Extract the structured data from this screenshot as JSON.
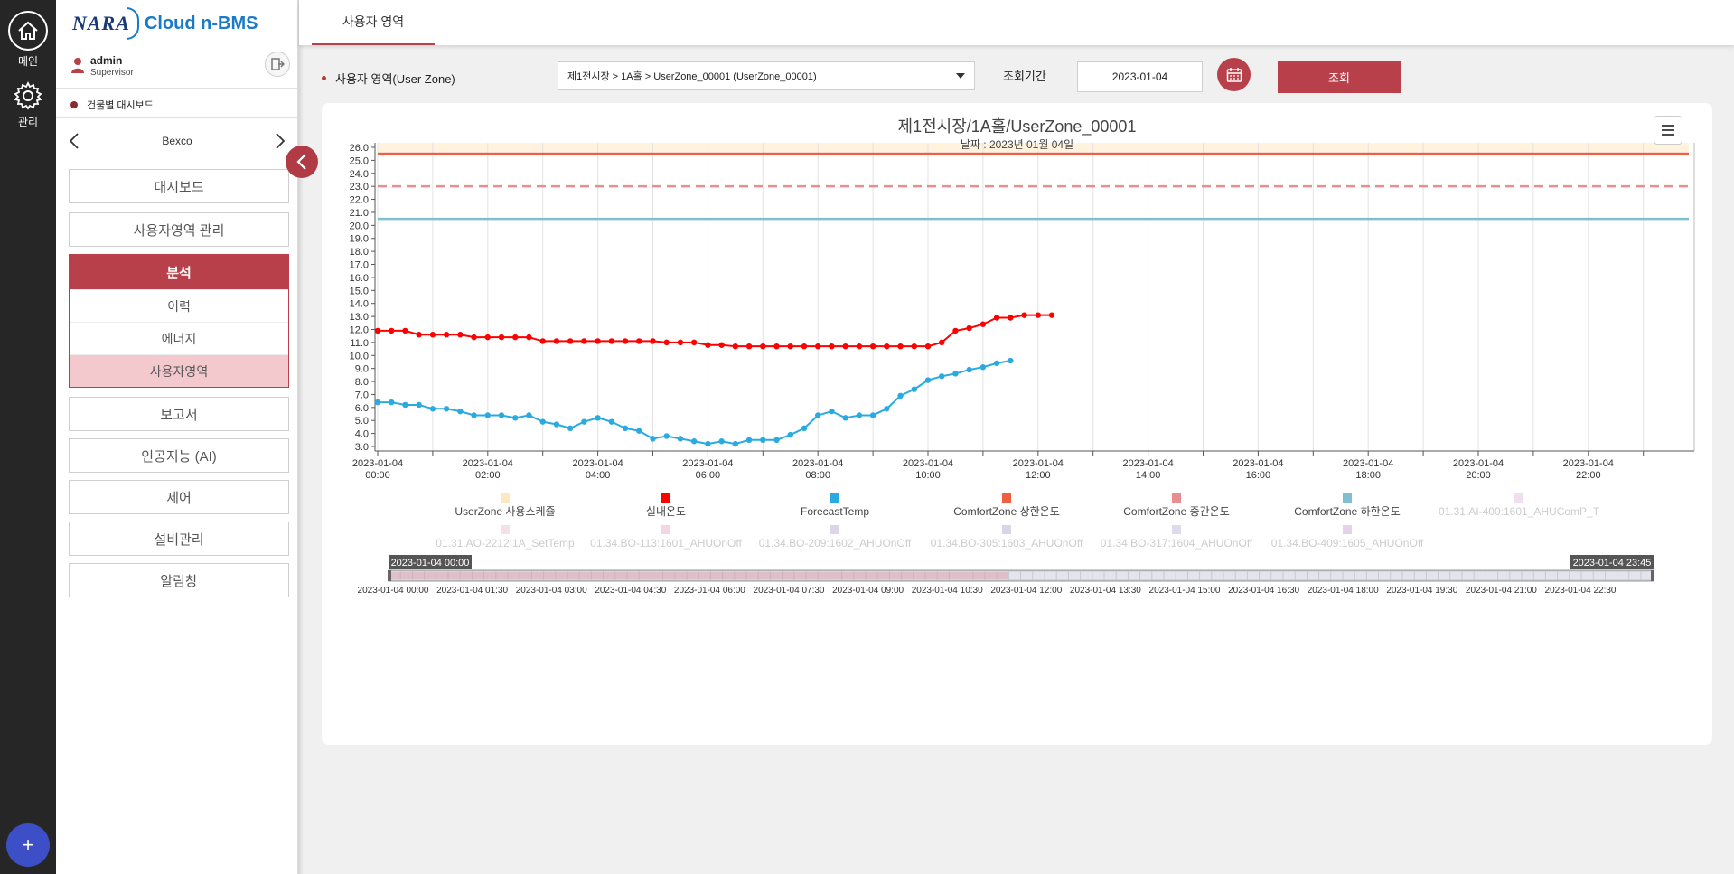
{
  "rail": {
    "main_label": "메인",
    "admin_label": "관리",
    "fab": "+"
  },
  "brand": {
    "nara": "NARA",
    "product": "Cloud n-BMS"
  },
  "user": {
    "name": "admin",
    "role": "Supervisor"
  },
  "building_dashboard": "건물별 대시보드",
  "site": "Bexco",
  "menu": {
    "dashboard": "대시보드",
    "userzone_mgmt": "사용자영역 관리",
    "analysis": "분석",
    "analysis_items": [
      "이력",
      "에너지",
      "사용자영역"
    ],
    "report": "보고서",
    "ai": "인공지능 (AI)",
    "control": "제어",
    "equipment": "설비관리",
    "alarm": "알림창"
  },
  "tab": {
    "label": "사용자 영역"
  },
  "filter": {
    "zone_label": "사용자 영역(User Zone)",
    "zone_value": "제1전시장 > 1A홀 > UserZone_00001 (UserZone_00001)",
    "period_label": "조회기간",
    "date": "2023-01-04",
    "query_label": "조회"
  },
  "colors": {
    "brand_red": "#b8404a",
    "indoor": "#ff0000",
    "forecast": "#29abe2",
    "upper": "#f06040",
    "middle": "#e88e90",
    "lower": "#7ec0d0",
    "schedule": "#fff3dd"
  },
  "chart_data": {
    "type": "line",
    "title": "제1전시장/1A홀/UserZone_00001",
    "subtitle": "날짜 : 2023년 01월 04일",
    "ylim": [
      3.0,
      26.0
    ],
    "y_ticks": [
      "3.0",
      "4.0",
      "5.0",
      "6.0",
      "7.0",
      "8.0",
      "9.0",
      "10.0",
      "11.0",
      "12.0",
      "13.0",
      "14.0",
      "15.0",
      "16.0",
      "17.0",
      "18.0",
      "19.0",
      "20.0",
      "21.0",
      "22.0",
      "23.0",
      "24.0",
      "25.0",
      "26.0"
    ],
    "x_ticks": [
      [
        "2023-01-04",
        "00:00"
      ],
      [
        "2023-01-04",
        "02:00"
      ],
      [
        "2023-01-04",
        "04:00"
      ],
      [
        "2023-01-04",
        "06:00"
      ],
      [
        "2023-01-04",
        "08:00"
      ],
      [
        "2023-01-04",
        "10:00"
      ],
      [
        "2023-01-04",
        "12:00"
      ],
      [
        "2023-01-04",
        "14:00"
      ],
      [
        "2023-01-04",
        "16:00"
      ],
      [
        "2023-01-04",
        "18:00"
      ],
      [
        "2023-01-04",
        "20:00"
      ],
      [
        "2023-01-04",
        "22:00"
      ]
    ],
    "x_interval_minutes": 15,
    "series": [
      {
        "name": "실내온도",
        "values": [
          11.9,
          11.9,
          11.9,
          11.6,
          11.6,
          11.6,
          11.6,
          11.4,
          11.4,
          11.4,
          11.4,
          11.4,
          11.1,
          11.1,
          11.1,
          11.1,
          11.1,
          11.1,
          11.1,
          11.1,
          11.1,
          11.0,
          11.0,
          11.0,
          10.8,
          10.8,
          10.7,
          10.7,
          10.7,
          10.7,
          10.7,
          10.7,
          10.7,
          10.7,
          10.7,
          10.7,
          10.7,
          10.7,
          10.7,
          10.7,
          10.7,
          11.0,
          11.9,
          12.1,
          12.4,
          12.9,
          12.9,
          13.1,
          13.1,
          13.1
        ]
      },
      {
        "name": "ForecastTemp",
        "values": [
          6.4,
          6.4,
          6.2,
          6.2,
          5.9,
          5.9,
          5.7,
          5.4,
          5.4,
          5.4,
          5.2,
          5.4,
          4.9,
          4.7,
          4.4,
          4.9,
          5.2,
          4.9,
          4.4,
          4.2,
          3.6,
          3.8,
          3.6,
          3.4,
          3.2,
          3.4,
          3.2,
          3.5,
          3.5,
          3.5,
          3.9,
          4.4,
          5.4,
          5.7,
          5.2,
          5.4,
          5.4,
          5.9,
          6.9,
          7.4,
          8.1,
          8.4,
          8.6,
          8.9,
          9.1,
          9.4,
          9.6
        ]
      },
      {
        "name": "ComfortZone 상한온도",
        "values": [
          25.5
        ]
      },
      {
        "name": "ComfortZone 중간온도",
        "values": [
          23.0
        ]
      },
      {
        "name": "ComfortZone 하한온도",
        "values": [
          20.5
        ]
      }
    ],
    "legend": [
      {
        "label": "UserZone 사용스케쥴",
        "color": "#ffe7c4",
        "active": true
      },
      {
        "label": "실내온도",
        "color": "#ff0000",
        "active": true
      },
      {
        "label": "ForecastTemp",
        "color": "#29abe2",
        "active": true
      },
      {
        "label": "ComfortZone 상한온도",
        "color": "#f06040",
        "active": true
      },
      {
        "label": "ComfortZone 중간온도",
        "color": "#e88e90",
        "active": true
      },
      {
        "label": "ComfortZone 하한온도",
        "color": "#7ec0d0",
        "active": true
      },
      {
        "label": "01.31.AI-400:1601_AHUComP_T",
        "color": "#f0dff0",
        "active": false
      },
      {
        "label": "01.31.AO-2212:1A_SetTemp",
        "color": "#f5dfe8",
        "active": false
      },
      {
        "label": "01.34.BO-113:1601_AHUOnOff",
        "color": "#f3d6e4",
        "active": false
      },
      {
        "label": "01.34.BO-209:1602_AHUOnOff",
        "color": "#dfd3e8",
        "active": false
      },
      {
        "label": "01.34.BO-305:1603_AHUOnOff",
        "color": "#d6d6e8",
        "active": false
      },
      {
        "label": "01.34.BO-317:1604_AHUOnOff",
        "color": "#dcdcec",
        "active": false
      },
      {
        "label": "01.34.BO-409:1605_AHUOnOff",
        "color": "#e4d2e6",
        "active": false
      }
    ],
    "navigator": {
      "start": "2023-01-04 00:00",
      "end": "2023-01-04 23:45",
      "ticks": [
        "2023-01-04 00:00",
        "2023-01-04 01:30",
        "2023-01-04 03:00",
        "2023-01-04 04:30",
        "2023-01-04 06:00",
        "2023-01-04 07:30",
        "2023-01-04 09:00",
        "2023-01-04 10:30",
        "2023-01-04 12:00",
        "2023-01-04 13:30",
        "2023-01-04 15:00",
        "2023-01-04 16:30",
        "2023-01-04 18:00",
        "2023-01-04 19:30",
        "2023-01-04 21:00",
        "2023-01-04 22:30"
      ]
    }
  }
}
